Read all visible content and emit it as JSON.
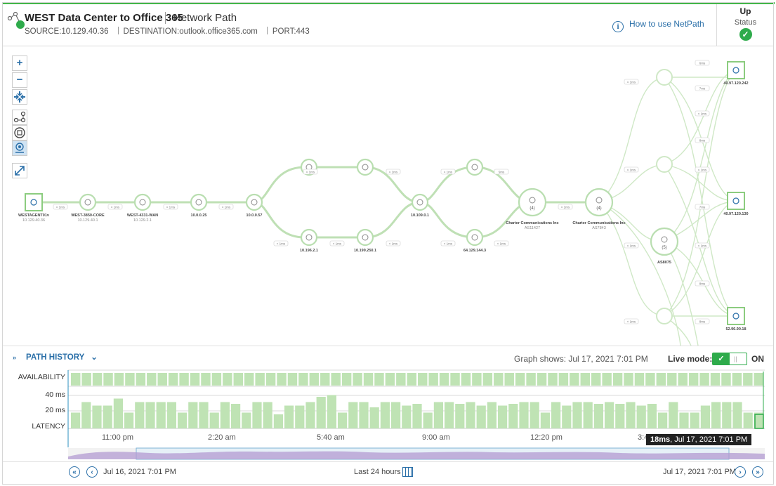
{
  "header": {
    "title": "WEST Data Center to Office 365",
    "subtitle": "Network Path",
    "source": "SOURCE:10.129.40.36",
    "destination": "DESTINATION:outlook.office365.com",
    "port": "PORT:443",
    "how_to": "How to use NetPath",
    "status_value": "Up",
    "status_label": "Status",
    "status_color": "#2eab4b"
  },
  "toolbar": {
    "zoom_in": "+",
    "zoom_out": "−",
    "icons": [
      "zoom-in-icon",
      "zoom-out-icon",
      "fit-to-screen-icon",
      "path-view-icon",
      "node-view-icon",
      "legend-icon",
      "expand-icon"
    ]
  },
  "path": {
    "nodes": [
      {
        "id": "agent",
        "label": "WESTAGENT01v",
        "sub": "10.129.40.36"
      },
      {
        "id": "core",
        "label": "WEST-3850-CORE",
        "sub": "10.129.40.1"
      },
      {
        "id": "wan",
        "label": "WEST-4331-WAN",
        "sub": "10.129.2.1"
      },
      {
        "id": "n1",
        "label": "10.0.0.25",
        "sub": ""
      },
      {
        "id": "n2",
        "label": "10.0.0.57",
        "sub": ""
      },
      {
        "id": "n3",
        "label": "",
        "sub": ""
      },
      {
        "id": "n4",
        "label": "",
        "sub": ""
      },
      {
        "id": "n5",
        "label": "10.196.2.1",
        "sub": ""
      },
      {
        "id": "n6",
        "label": "10.199.250.1",
        "sub": ""
      },
      {
        "id": "n7",
        "label": "10.109.0.1",
        "sub": ""
      },
      {
        "id": "n8",
        "label": "",
        "sub": ""
      },
      {
        "id": "n9",
        "label": "64.129.144.3",
        "sub": ""
      },
      {
        "id": "c1",
        "label": "Charter Communications Inc",
        "sub": "AS11427",
        "count": "(4)"
      },
      {
        "id": "c2",
        "label": "Charter Communications Inc",
        "sub": "AS7843",
        "count": "(4)"
      },
      {
        "id": "as",
        "label": "AS8075",
        "sub": "",
        "count": "(5)"
      },
      {
        "id": "d1",
        "label": "40.97.120.242",
        "sub": ""
      },
      {
        "id": "d2",
        "label": "40.97.120.130",
        "sub": ""
      },
      {
        "id": "d3",
        "label": "52.96.90.18",
        "sub": ""
      }
    ],
    "latencies": {
      "lt1": "< 1ms",
      "m5": "5ms",
      "m6": "6ms",
      "m7": "7ms",
      "m8": "8ms"
    }
  },
  "history": {
    "title": "PATH HISTORY",
    "graph_shows": "Graph shows: Jul 17, 2021 7:01 PM",
    "live_label": "Live mode:",
    "live_state": "ON",
    "availability_label": "AVAILABILITY",
    "latency_label": "LATENCY",
    "y_ticks": [
      "40 ms",
      "20 ms"
    ],
    "x_ticks": [
      "11:00 pm",
      "2:20 am",
      "5:40 am",
      "9:00 am",
      "12:20 pm",
      "3:4"
    ],
    "tooltip_value": "18ms",
    "tooltip_time": ", Jul 17, 2021 7:01 PM"
  },
  "chart_data": {
    "type": "bar",
    "title": "",
    "ylabel": "LATENCY",
    "ylim": [
      0,
      48
    ],
    "y_ticks": [
      20,
      40
    ],
    "x_ticks": [
      "11:00 pm",
      "2:20 am",
      "5:40 am",
      "9:00 am",
      "12:20 pm",
      "3:4"
    ],
    "availability_count": 64,
    "series": [
      {
        "values": [
          18,
          30,
          26,
          26,
          34,
          18,
          30,
          30,
          30,
          30,
          18,
          30,
          30,
          18,
          30,
          28,
          18,
          30,
          30,
          16,
          26,
          26,
          30,
          36,
          38,
          18,
          30,
          30,
          24,
          30,
          30,
          26,
          28,
          18,
          30,
          30,
          28,
          30,
          26,
          30,
          26,
          28,
          30,
          30,
          18,
          30,
          26,
          30,
          30,
          28,
          30,
          28,
          30,
          26,
          28,
          18,
          30,
          18,
          18,
          26,
          30,
          30,
          30,
          18,
          18
        ]
      }
    ]
  },
  "footer": {
    "start": "Jul 16, 2021 7:01 PM",
    "range": "Last 24 hours",
    "end": "Jul 17, 2021 7:01 PM"
  }
}
